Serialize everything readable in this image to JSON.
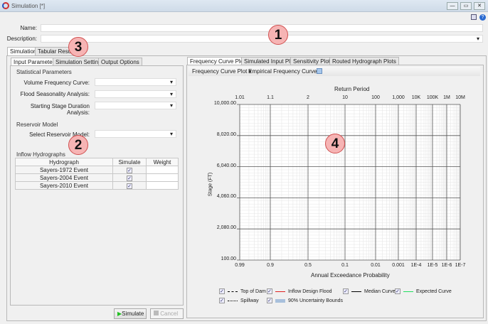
{
  "window": {
    "title": "Simulation [*]",
    "buttons": [
      "—",
      "▭",
      "✕"
    ]
  },
  "form": {
    "name_label": "Name:",
    "name_value": "",
    "description_label": "Description:",
    "description_value": ""
  },
  "main_tabs": [
    "Simulation",
    "Tabular Results"
  ],
  "sub_tabs": [
    "Input Parameters",
    "Simulation Settings",
    "Output Options"
  ],
  "statistical": {
    "title": "Statistical Parameters",
    "fields": [
      {
        "label": "Volume Frequency Curve:",
        "value": ""
      },
      {
        "label": "Flood Seasonality Analysis:",
        "value": ""
      },
      {
        "label": "Starting Stage Duration Analysis:",
        "value": ""
      }
    ]
  },
  "reservoir": {
    "title": "Reservoir Model",
    "label": "Select Reservoir Model:",
    "value": ""
  },
  "inflow": {
    "title": "Inflow Hydrographs",
    "columns": [
      "Hydrograph",
      "Simulate",
      "Weight"
    ],
    "rows": [
      {
        "name": "Sayers-1972 Event",
        "simulate": true,
        "weight": ""
      },
      {
        "name": "Sayers-2004 Event",
        "simulate": true,
        "weight": ""
      },
      {
        "name": "Sayers-2010 Event",
        "simulate": true,
        "weight": ""
      }
    ]
  },
  "actions": {
    "simulate": "Simulate",
    "cancel": "Cancel"
  },
  "plot_tabs": [
    "Frequency Curve Plots",
    "Simulated Input Plots",
    "Sensitivity Plots",
    "Routed Hydrograph Plots"
  ],
  "plot_toolbar": {
    "plot_type": "Frequency Curve Plot",
    "curve_type": "Empirical Frequency Curve"
  },
  "chart": {
    "top_title": "Return Period",
    "top_ticks": [
      "1.01",
      "1.1",
      "2",
      "10",
      "100",
      "1,000",
      "10K",
      "100K",
      "1M",
      "10M"
    ],
    "bottom_ticks": [
      "0.99",
      "0.9",
      "0.5",
      "0.1",
      "0.01",
      "0.001",
      "1E-4",
      "1E-5",
      "1E-6",
      "1E-7"
    ],
    "xlabel": "Annual Exceedance Probability",
    "ylabel": "Stage (FT)",
    "y_ticks": [
      "10,000.00",
      "8,020.00",
      "6,040.00",
      "4,060.00",
      "2,080.00",
      "100.00"
    ],
    "ylim": [
      100,
      10000
    ]
  },
  "legend": [
    {
      "label": "Top of Dam",
      "style": "dashed",
      "color": "#000000"
    },
    {
      "label": "Inflow Design Flood",
      "style": "solid",
      "color": "#e02020"
    },
    {
      "label": "Median Curve",
      "style": "solid",
      "color": "#000000"
    },
    {
      "label": "Expected Curve",
      "style": "solid",
      "color": "#20e060"
    },
    {
      "label": "Spillway",
      "style": "dotted",
      "color": "#000000"
    },
    {
      "label": "90% Uncertainty Bounds",
      "style": "fill",
      "color": "#a8c0dc"
    }
  ],
  "annotations": [
    "1",
    "2",
    "3",
    "4"
  ]
}
